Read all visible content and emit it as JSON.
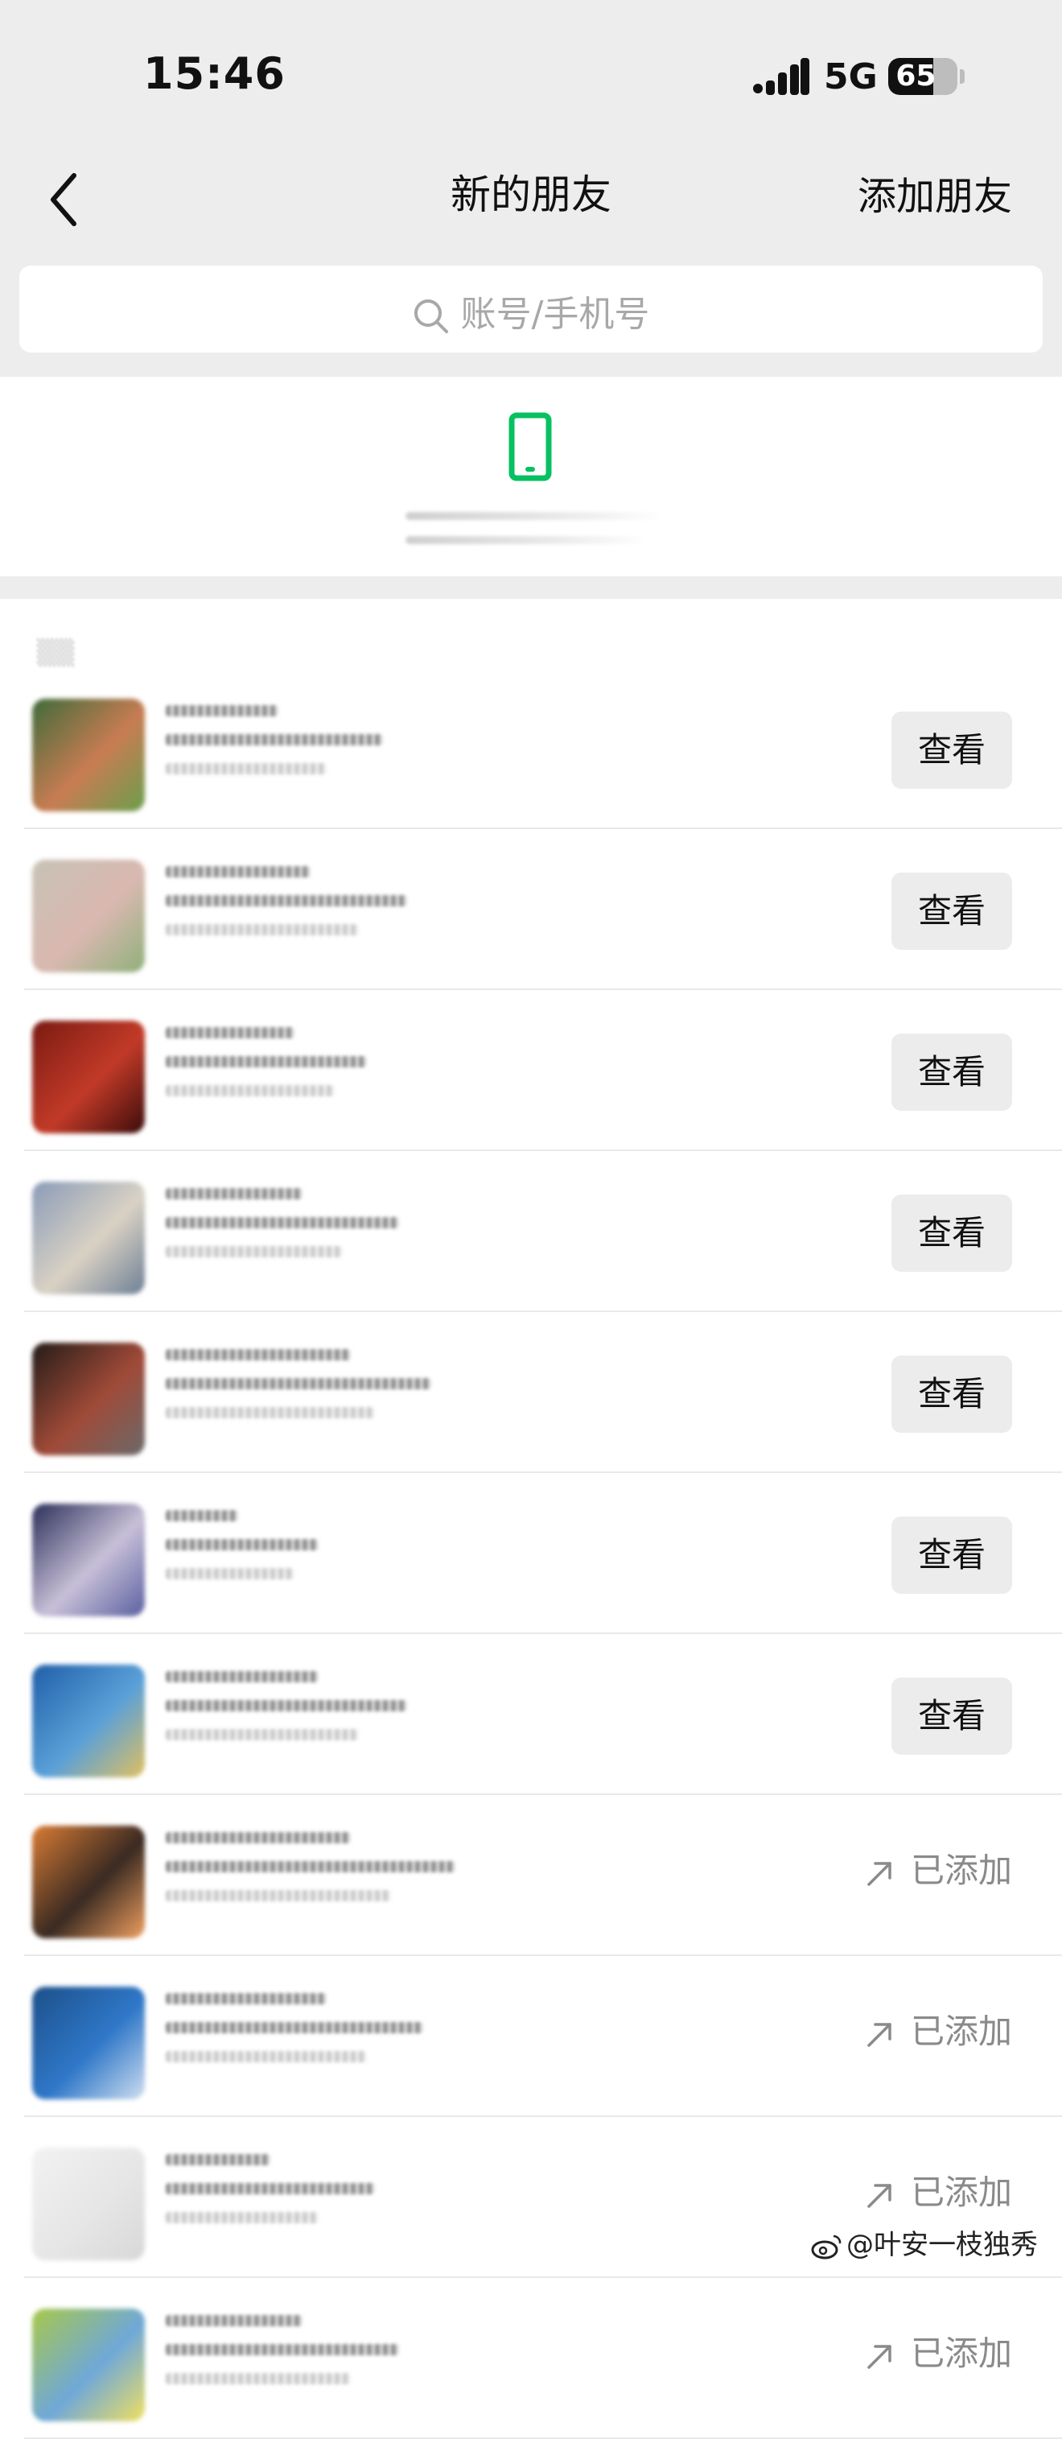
{
  "status_bar": {
    "time": "15:46",
    "network": "5G",
    "battery": "65",
    "battery_level": 0.65
  },
  "nav": {
    "title": "新的朋友",
    "action": "添加朋友"
  },
  "search": {
    "placeholder": "账号/手机号"
  },
  "list": {
    "rows": [
      {
        "action_type": "button",
        "label": "查看"
      },
      {
        "action_type": "button",
        "label": "查看"
      },
      {
        "action_type": "button",
        "label": "查看"
      },
      {
        "action_type": "button",
        "label": "查看"
      },
      {
        "action_type": "button",
        "label": "查看"
      },
      {
        "action_type": "button",
        "label": "查看"
      },
      {
        "action_type": "button",
        "label": "查看"
      },
      {
        "action_type": "status",
        "label": "已添加"
      },
      {
        "action_type": "status",
        "label": "已添加"
      },
      {
        "action_type": "status",
        "label": "已添加"
      },
      {
        "action_type": "status",
        "label": "已添加"
      }
    ]
  },
  "watermark": {
    "text": "@叶安一枝独秀",
    "icon": "weibo-icon"
  },
  "colors": {
    "accent_green": "#07c160",
    "background_gray": "#ededed"
  }
}
